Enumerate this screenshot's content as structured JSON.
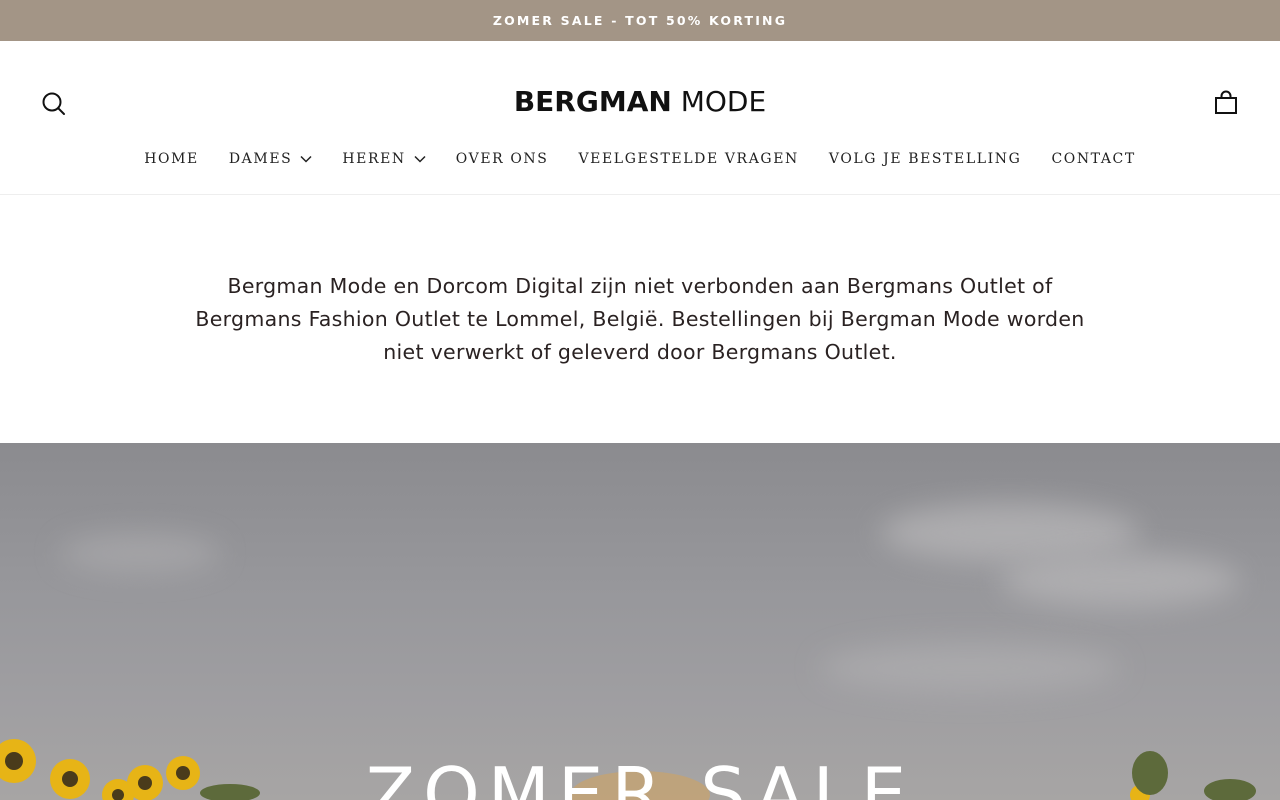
{
  "announcement": {
    "text": "ZOMER SALE - TOT 50% KORTING"
  },
  "header": {
    "logo": {
      "bold": "BERGMAN",
      "light": "MODE"
    },
    "icons": {
      "search": "search-icon",
      "cart": "bag-icon"
    }
  },
  "nav": {
    "items": [
      {
        "label": "HOME",
        "has_dropdown": false
      },
      {
        "label": "DAMES",
        "has_dropdown": true
      },
      {
        "label": "HEREN",
        "has_dropdown": true
      },
      {
        "label": "OVER ONS",
        "has_dropdown": false
      },
      {
        "label": "VEELGESTELDE VRAGEN",
        "has_dropdown": false
      },
      {
        "label": "VOLG JE BESTELLING",
        "has_dropdown": false
      },
      {
        "label": "CONTACT",
        "has_dropdown": false
      }
    ]
  },
  "notice": {
    "line1": "Bergman Mode en Dorcom Digital zijn niet verbonden aan Bergmans Outlet of",
    "line2": "Bergmans Fashion Outlet te Lommel, België. Bestellingen bij Bergman Mode worden",
    "line3": "niet verwerkt of geleverd door Bergmans Outlet."
  },
  "hero": {
    "title": "ZOMER SALE"
  },
  "colors": {
    "announcement_bg": "#a39586",
    "text": "#222222",
    "hero_sky": "#97979b"
  }
}
